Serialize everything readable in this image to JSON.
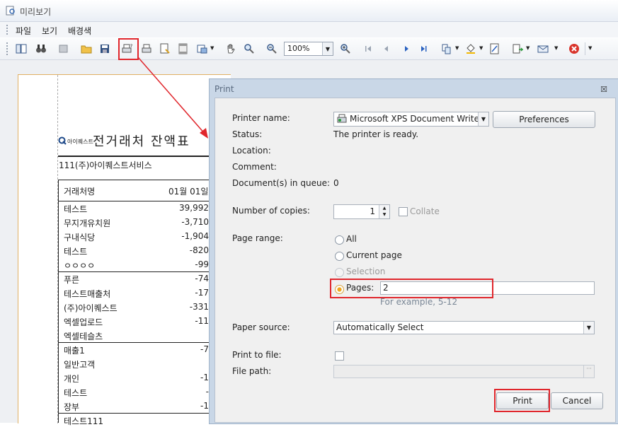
{
  "window": {
    "title": "미리보기"
  },
  "menu": [
    "파일",
    "보기",
    "배경색"
  ],
  "toolbar": {
    "zoom": "100%"
  },
  "report": {
    "title": "전거래처 잔액표",
    "logo_text": "아이퀘스트",
    "company": "111(주)아이퀘스트서비스",
    "col_name": "거래처명",
    "col_date": "01월 01일",
    "rows": [
      {
        "name": "테스트",
        "value": "39,992"
      },
      {
        "name": "무지개유치원",
        "value": "-3,710"
      },
      {
        "name": "구내식당",
        "value": "-1,904"
      },
      {
        "name": "테스트",
        "value": "-820"
      },
      {
        "name": "ㅇㅇㅇㅇ",
        "value": "-99"
      },
      {
        "name": "푸른",
        "value": "-74"
      },
      {
        "name": "테스트매출처",
        "value": "-17"
      },
      {
        "name": "(주)아이퀘스트",
        "value": "-331"
      },
      {
        "name": "엑셀업로드",
        "value": "-11"
      },
      {
        "name": "엑셀테슬츠",
        "value": ""
      },
      {
        "name": "매출1",
        "value": "-7"
      },
      {
        "name": "일반고객",
        "value": ""
      },
      {
        "name": "개인",
        "value": "-1"
      },
      {
        "name": "테스트",
        "value": "-"
      },
      {
        "name": "장부",
        "value": "-1"
      },
      {
        "name": "테스트111",
        "value": ""
      }
    ]
  },
  "dialog": {
    "title": "Print",
    "close": "☒",
    "labels": {
      "printer_name": "Printer name:",
      "status": "Status:",
      "location": "Location:",
      "comment": "Comment:",
      "queue": "Document(s) in queue:",
      "copies": "Number of copies:",
      "page_range": "Page range:",
      "paper_source": "Paper source:",
      "print_to_file": "Print to file:",
      "file_path": "File path:"
    },
    "printer": "Microsoft XPS Document Writer",
    "preferences": "Preferences",
    "status": "The printer is ready.",
    "queue": "0",
    "copies": "1",
    "collate": "Collate",
    "range_all": "All",
    "range_current": "Current page",
    "range_selection": "Selection",
    "range_pages": "Pages:",
    "pages_value": "2",
    "pages_example": "For example, 5-12",
    "paper_source": "Automatically Select",
    "file_browse": "···",
    "print": "Print",
    "cancel": "Cancel"
  },
  "colors": {
    "highlight": "#e0262c",
    "dialog_frame": "#c9d7e7"
  }
}
